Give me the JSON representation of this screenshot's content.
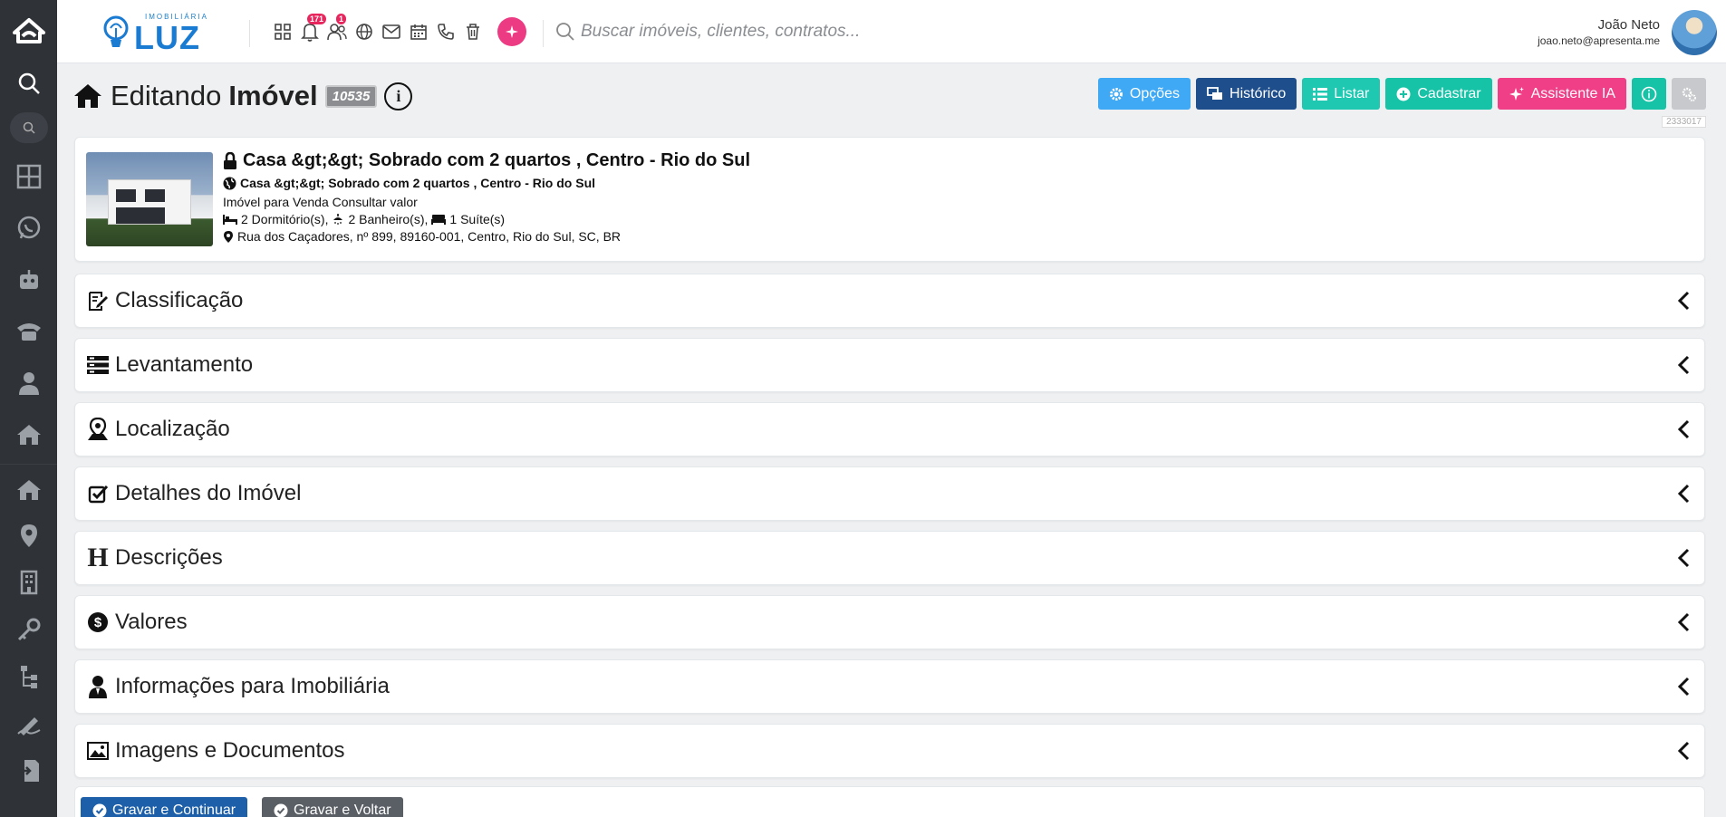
{
  "topbar": {
    "brand_small": "IMOBILIÁRIA",
    "brand_name": "LUZ",
    "notifications_badge": "171",
    "users_badge": "1",
    "search_placeholder": "Buscar imóveis, clientes, contratos...",
    "user_name": "João Neto",
    "user_email": "joao.neto@apresenta.me"
  },
  "header": {
    "title_prefix": "Editando",
    "title_entity": "Imóvel",
    "record_id": "10535",
    "version_code": "2333017"
  },
  "actions": {
    "opcoes": "Opções",
    "historico": "Histórico",
    "listar": "Listar",
    "cadastrar": "Cadastrar",
    "assistente": "Assistente IA"
  },
  "property": {
    "title": "Casa &gt;&gt; Sobrado com 2 quartos , Centro - Rio do Sul",
    "subtitle": "Casa &gt;&gt; Sobrado com 2 quartos , Centro - Rio do Sul",
    "status_line": "Imóvel para Venda Consultar valor",
    "rooms": {
      "bedrooms": "2 Dormitório(s),",
      "bathrooms": "2 Banheiro(s),",
      "suites": "1 Suíte(s)"
    },
    "address": "Rua dos Caçadores, nº 899, 89160-001, Centro, Rio do Sul, SC, BR"
  },
  "sections": [
    {
      "label": "Classificação",
      "icon": "edit-doc-icon"
    },
    {
      "label": "Levantamento",
      "icon": "list-bars-icon"
    },
    {
      "label": "Localização",
      "icon": "map-pin-person-icon"
    },
    {
      "label": "Detalhes do Imóvel",
      "icon": "check-square-icon"
    },
    {
      "label": "Descrições",
      "icon": "heading-h-icon"
    },
    {
      "label": "Valores",
      "icon": "dollar-circle-icon"
    },
    {
      "label": "Informações para Imobiliária",
      "icon": "agent-icon"
    },
    {
      "label": "Imagens e Documentos",
      "icon": "image-icon"
    }
  ],
  "footer": {
    "save_continue": "Gravar e Continuar",
    "save_back": "Gravar e Voltar"
  },
  "colors": {
    "sidebar": "#2f3237",
    "opcoes": "#3fa9f5",
    "historico": "#1e4e8c",
    "listar": "#1ec8b1",
    "assistente": "#f03e87",
    "brand": "#1a7bd2"
  }
}
